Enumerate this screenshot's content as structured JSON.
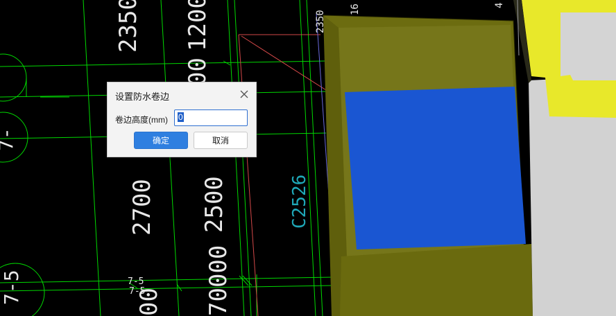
{
  "drawing": {
    "dimensions": [
      "2350",
      "1200",
      "00",
      "2700",
      "2500",
      "70000",
      "00",
      "2350",
      "16",
      "4"
    ],
    "column_labels": [
      "C2526"
    ],
    "axis_labels": [
      "7-5",
      "7-5",
      "7-5",
      "7-"
    ],
    "colors": {
      "background": "#000000",
      "grid_lines": "#00d800",
      "dimension_text": "#e8e8e8",
      "cyan_label": "#1fa8b8",
      "red_line": "#d24848",
      "olive_wall": "#6c6c10",
      "blue_face": "#1a56d2",
      "yellow": "#e8e82a",
      "gray": "#d0d0d0"
    }
  },
  "dialog": {
    "title": "设置防水卷边",
    "field_label": "卷边高度(mm)",
    "field_value": "0",
    "ok_label": "确定",
    "cancel_label": "取消",
    "close_icon": "close-icon"
  }
}
